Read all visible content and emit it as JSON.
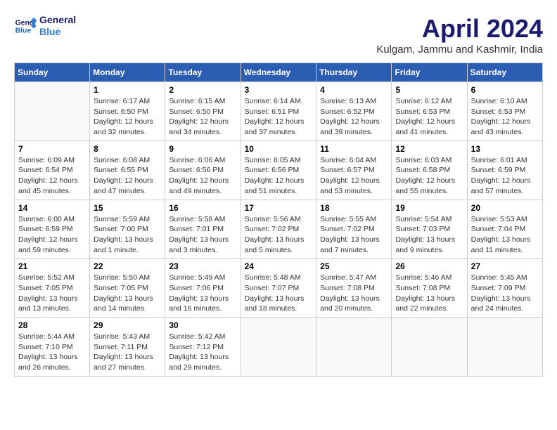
{
  "header": {
    "logo_line1": "General",
    "logo_line2": "Blue",
    "month_title": "April 2024",
    "location": "Kulgam, Jammu and Kashmir, India"
  },
  "days_of_week": [
    "Sunday",
    "Monday",
    "Tuesday",
    "Wednesday",
    "Thursday",
    "Friday",
    "Saturday"
  ],
  "weeks": [
    [
      {
        "num": "",
        "info": ""
      },
      {
        "num": "1",
        "info": "Sunrise: 6:17 AM\nSunset: 6:50 PM\nDaylight: 12 hours\nand 32 minutes."
      },
      {
        "num": "2",
        "info": "Sunrise: 6:15 AM\nSunset: 6:50 PM\nDaylight: 12 hours\nand 34 minutes."
      },
      {
        "num": "3",
        "info": "Sunrise: 6:14 AM\nSunset: 6:51 PM\nDaylight: 12 hours\nand 37 minutes."
      },
      {
        "num": "4",
        "info": "Sunrise: 6:13 AM\nSunset: 6:52 PM\nDaylight: 12 hours\nand 39 minutes."
      },
      {
        "num": "5",
        "info": "Sunrise: 6:12 AM\nSunset: 6:53 PM\nDaylight: 12 hours\nand 41 minutes."
      },
      {
        "num": "6",
        "info": "Sunrise: 6:10 AM\nSunset: 6:53 PM\nDaylight: 12 hours\nand 43 minutes."
      }
    ],
    [
      {
        "num": "7",
        "info": "Sunrise: 6:09 AM\nSunset: 6:54 PM\nDaylight: 12 hours\nand 45 minutes."
      },
      {
        "num": "8",
        "info": "Sunrise: 6:08 AM\nSunset: 6:55 PM\nDaylight: 12 hours\nand 47 minutes."
      },
      {
        "num": "9",
        "info": "Sunrise: 6:06 AM\nSunset: 6:56 PM\nDaylight: 12 hours\nand 49 minutes."
      },
      {
        "num": "10",
        "info": "Sunrise: 6:05 AM\nSunset: 6:56 PM\nDaylight: 12 hours\nand 51 minutes."
      },
      {
        "num": "11",
        "info": "Sunrise: 6:04 AM\nSunset: 6:57 PM\nDaylight: 12 hours\nand 53 minutes."
      },
      {
        "num": "12",
        "info": "Sunrise: 6:03 AM\nSunset: 6:58 PM\nDaylight: 12 hours\nand 55 minutes."
      },
      {
        "num": "13",
        "info": "Sunrise: 6:01 AM\nSunset: 6:59 PM\nDaylight: 12 hours\nand 57 minutes."
      }
    ],
    [
      {
        "num": "14",
        "info": "Sunrise: 6:00 AM\nSunset: 6:59 PM\nDaylight: 12 hours\nand 59 minutes."
      },
      {
        "num": "15",
        "info": "Sunrise: 5:59 AM\nSunset: 7:00 PM\nDaylight: 13 hours\nand 1 minute."
      },
      {
        "num": "16",
        "info": "Sunrise: 5:58 AM\nSunset: 7:01 PM\nDaylight: 13 hours\nand 3 minutes."
      },
      {
        "num": "17",
        "info": "Sunrise: 5:56 AM\nSunset: 7:02 PM\nDaylight: 13 hours\nand 5 minutes."
      },
      {
        "num": "18",
        "info": "Sunrise: 5:55 AM\nSunset: 7:02 PM\nDaylight: 13 hours\nand 7 minutes."
      },
      {
        "num": "19",
        "info": "Sunrise: 5:54 AM\nSunset: 7:03 PM\nDaylight: 13 hours\nand 9 minutes."
      },
      {
        "num": "20",
        "info": "Sunrise: 5:53 AM\nSunset: 7:04 PM\nDaylight: 13 hours\nand 11 minutes."
      }
    ],
    [
      {
        "num": "21",
        "info": "Sunrise: 5:52 AM\nSunset: 7:05 PM\nDaylight: 13 hours\nand 13 minutes."
      },
      {
        "num": "22",
        "info": "Sunrise: 5:50 AM\nSunset: 7:05 PM\nDaylight: 13 hours\nand 14 minutes."
      },
      {
        "num": "23",
        "info": "Sunrise: 5:49 AM\nSunset: 7:06 PM\nDaylight: 13 hours\nand 16 minutes."
      },
      {
        "num": "24",
        "info": "Sunrise: 5:48 AM\nSunset: 7:07 PM\nDaylight: 13 hours\nand 18 minutes."
      },
      {
        "num": "25",
        "info": "Sunrise: 5:47 AM\nSunset: 7:08 PM\nDaylight: 13 hours\nand 20 minutes."
      },
      {
        "num": "26",
        "info": "Sunrise: 5:46 AM\nSunset: 7:08 PM\nDaylight: 13 hours\nand 22 minutes."
      },
      {
        "num": "27",
        "info": "Sunrise: 5:45 AM\nSunset: 7:09 PM\nDaylight: 13 hours\nand 24 minutes."
      }
    ],
    [
      {
        "num": "28",
        "info": "Sunrise: 5:44 AM\nSunset: 7:10 PM\nDaylight: 13 hours\nand 26 minutes."
      },
      {
        "num": "29",
        "info": "Sunrise: 5:43 AM\nSunset: 7:11 PM\nDaylight: 13 hours\nand 27 minutes."
      },
      {
        "num": "30",
        "info": "Sunrise: 5:42 AM\nSunset: 7:12 PM\nDaylight: 13 hours\nand 29 minutes."
      },
      {
        "num": "",
        "info": ""
      },
      {
        "num": "",
        "info": ""
      },
      {
        "num": "",
        "info": ""
      },
      {
        "num": "",
        "info": ""
      }
    ]
  ]
}
